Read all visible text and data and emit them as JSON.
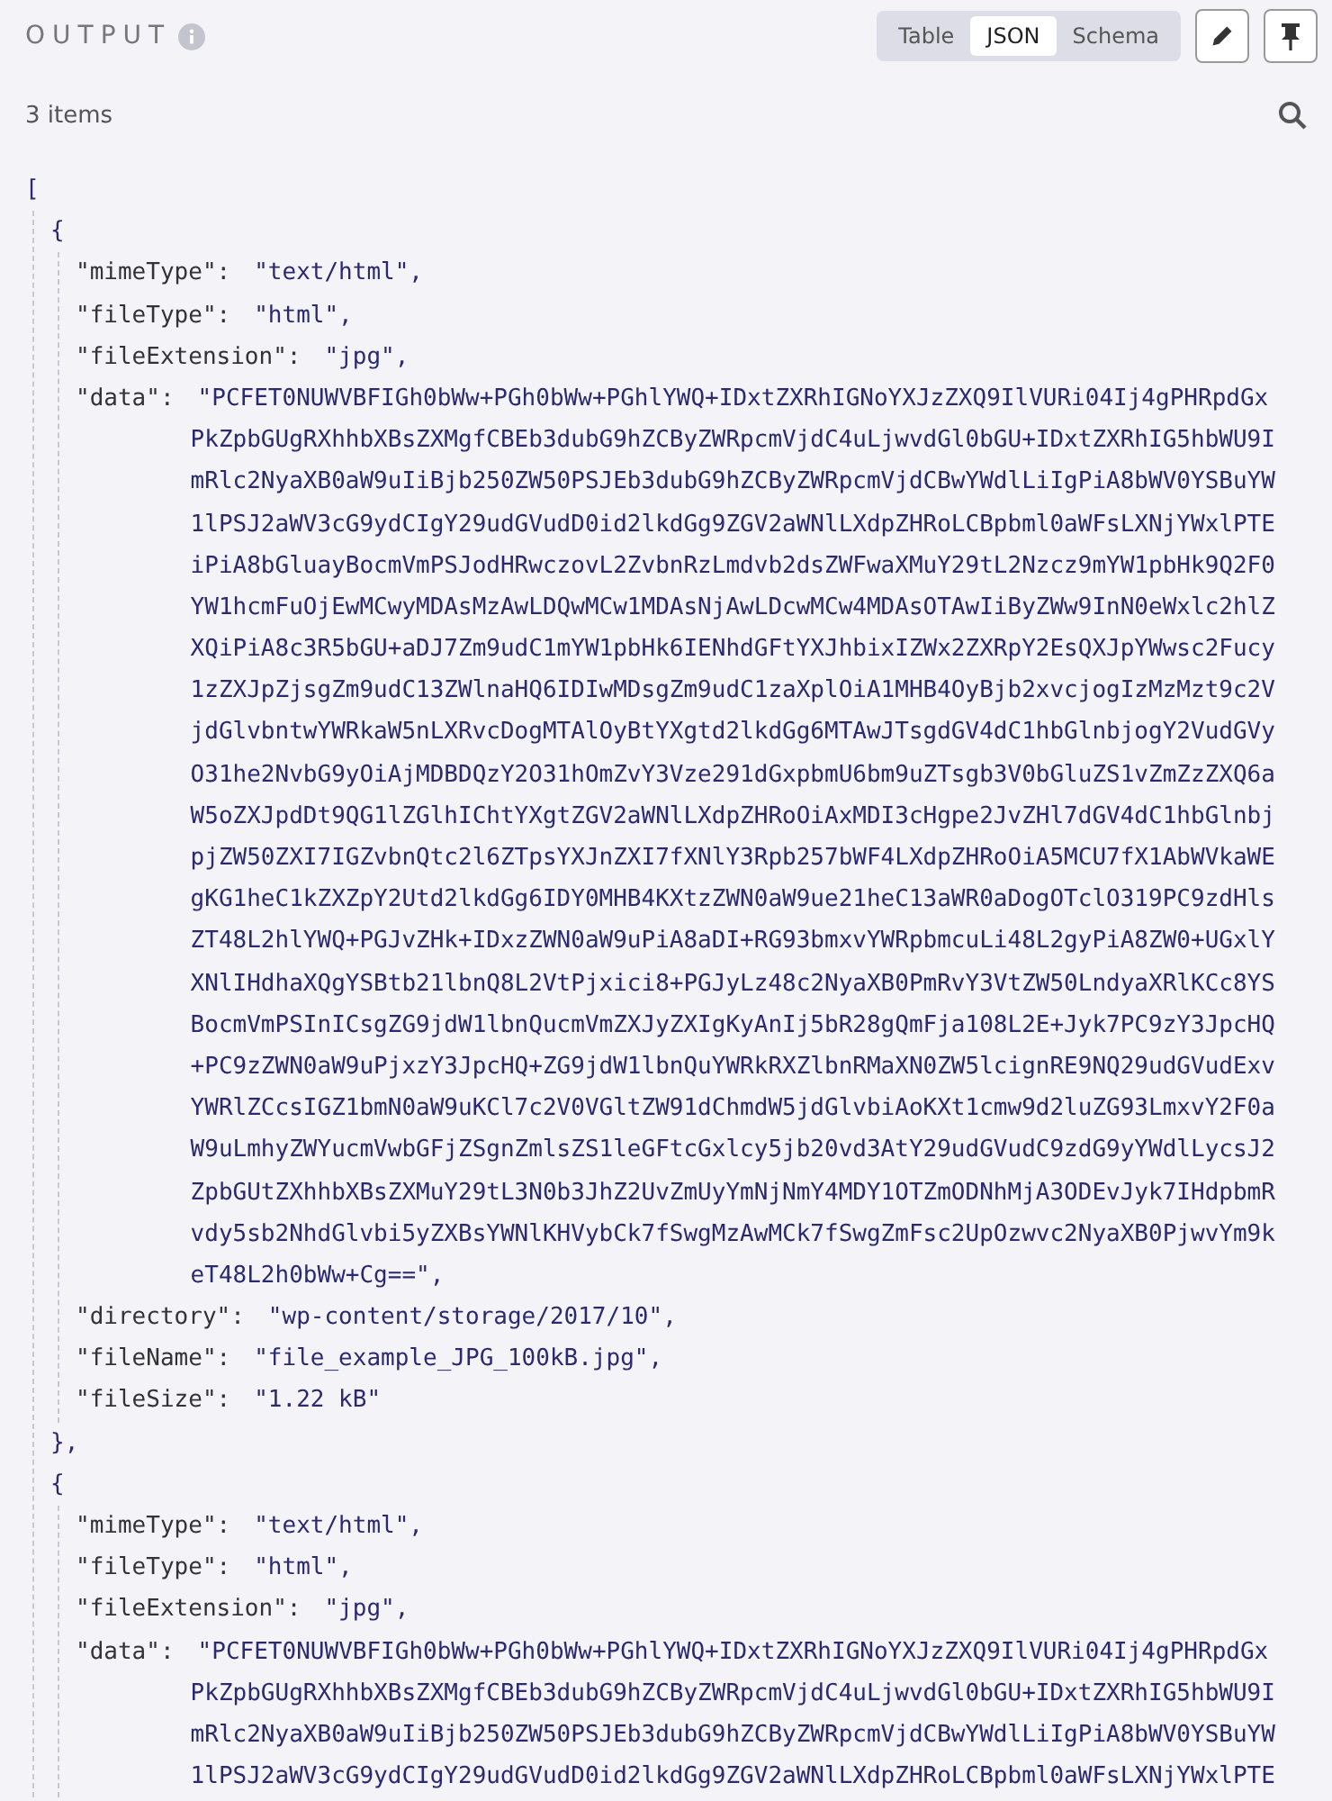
{
  "header": {
    "title": "OUTPUT",
    "tabs": [
      {
        "label": "Table",
        "selected": false
      },
      {
        "label": "JSON",
        "selected": true
      },
      {
        "label": "Schema",
        "selected": false
      }
    ]
  },
  "item_count": "3 items",
  "json": {
    "open": "[",
    "items": [
      {
        "open": "{",
        "fields": [
          {
            "key": "\"mimeType\":",
            "value": [
              "\"text/html\","
            ]
          },
          {
            "key": "\"fileType\":",
            "value": [
              "\"html\","
            ]
          },
          {
            "key": "\"fileExtension\":",
            "value": [
              "\"jpg\","
            ]
          },
          {
            "key": "\"data\":",
            "value": [
              "\"PCFET0NUWVBFIGh0bWw+PGh0bWw+PGhlYWQ+IDxtZXRhIGNoYXJzZXQ9IlVURi04Ij4gPHRpdGx",
              "PkZpbGUgRXhhbXBsZXMgfCBEb3dubG9hZCByZWRpcmVjdC4uLjwvdGl0bGU+IDxtZXRhIG5hbWU9I",
              "mRlc2NyaXB0aW9uIiBjb250ZW50PSJEb3dubG9hZCByZWRpcmVjdCBwYWdlLiIgPiA8bWV0YSBuYW",
              "1lPSJ2aWV3cG9ydCIgY29udGVudD0id2lkdGg9ZGV2aWNlLXdpZHRoLCBpbml0aWFsLXNjYWxlPTE",
              "iPiA8bGluayBocmVmPSJodHRwczovL2ZvbnRzLmdvb2dsZWFwaXMuY29tL2Nzcz9mYW1pbHk9Q2F0",
              "YW1hcmFuOjEwMCwyMDAsMzAwLDQwMCw1MDAsNjAwLDcwMCw4MDAsOTAwIiByZWw9InN0eWxlc2hlZ",
              "XQiPiA8c3R5bGU+aDJ7Zm9udC1mYW1pbHk6IENhdGFtYXJhbixIZWx2ZXRpY2EsQXJpYWwsc2Fucy",
              "1zZXJpZjsgZm9udC13ZWlnaHQ6IDIwMDsgZm9udC1zaXplOiA1MHB4OyBjb2xvcjogIzMzMzt9c2V",
              "jdGlvbntwYWRkaW5nLXRvcDogMTAlOyBtYXgtd2lkdGg6MTAwJTsgdGV4dC1hbGlnbjogY2VudGVy",
              "O31he2NvbG9yOiAjMDBDQzY2O31hOmZvY3Vze291dGxpbmU6bm9uZTsgb3V0bGluZS1vZmZzZXQ6a",
              "W5oZXJpdDt9QG1lZGlhIChtYXgtZGV2aWNlLXdpZHRoOiAxMDI3cHgpe2JvZHl7dGV4dC1hbGlnbj",
              "pjZW50ZXI7IGZvbnQtc2l6ZTpsYXJnZXI7fXNlY3Rpb257bWF4LXdpZHRoOiA5MCU7fX1AbWVkaWE",
              "gKG1heC1kZXZpY2Utd2lkdGg6IDY0MHB4KXtzZWN0aW9ue21heC13aWR0aDogOTclO319PC9zdHls",
              "ZT48L2hlYWQ+PGJvZHk+IDxzZWN0aW9uPiA8aDI+RG93bmxvYWRpbmcuLi48L2gyPiA8ZW0+UGxlY",
              "XNlIHdhaXQgYSBtb21lbnQ8L2VtPjxici8+PGJyLz48c2NyaXB0PmRvY3VtZW50LndyaXRlKCc8YS",
              "BocmVmPSInICsgZG9jdW1lbnQucmVmZXJyZXIgKyAnIj5bR28gQmFja108L2E+Jyk7PC9zY3JpcHQ",
              "+PC9zZWN0aW9uPjxzY3JpcHQ+ZG9jdW1lbnQuYWRkRXZlbnRMaXN0ZW5lcignRE9NQ29udGVudExv",
              "YWRlZCcsIGZ1bmN0aW9uKCl7c2V0VGltZW91dChmdW5jdGlvbiAoKXt1cmw9d2luZG93LmxvY2F0a",
              "W9uLmhyZWYucmVwbGFjZSgnZmlsZS1leGFtcGxlcy5jb20vd3AtY29udGVudC9zdG9yYWdlLycsJ2",
              "ZpbGUtZXhhbXBsZXMuY29tL3N0b3JhZ2UvZmUyYmNjNmY4MDY1OTZmODNhMjA3ODEvJyk7IHdpbmR",
              "vdy5sb2NhdGlvbi5yZXBsYWNlKHVybCk7fSwgMzAwMCk7fSwgZmFsc2UpOzwvc2NyaXB0PjwvYm9k",
              "eT48L2h0bWw+Cg==\","
            ]
          },
          {
            "key": "\"directory\":",
            "value": [
              "\"wp-content/storage/2017/10\","
            ]
          },
          {
            "key": "\"fileName\":",
            "value": [
              "\"file_example_JPG_100kB.jpg\","
            ]
          },
          {
            "key": "\"fileSize\":",
            "value": [
              "\"1.22 kB\""
            ]
          }
        ],
        "close": "},"
      },
      {
        "open": "{",
        "fields": [
          {
            "key": "\"mimeType\":",
            "value": [
              "\"text/html\","
            ]
          },
          {
            "key": "\"fileType\":",
            "value": [
              "\"html\","
            ]
          },
          {
            "key": "\"fileExtension\":",
            "value": [
              "\"jpg\","
            ]
          },
          {
            "key": "\"data\":",
            "value": [
              "\"PCFET0NUWVBFIGh0bWw+PGh0bWw+PGhlYWQ+IDxtZXRhIGNoYXJzZXQ9IlVURi04Ij4gPHRpdGx",
              "PkZpbGUgRXhhbXBsZXMgfCBEb3dubG9hZCByZWRpcmVjdC4uLjwvdGl0bGU+IDxtZXRhIG5hbWU9I",
              "mRlc2NyaXB0aW9uIiBjb250ZW50PSJEb3dubG9hZCByZWRpcmVjdCBwYWdlLiIgPiA8bWV0YSBuYW",
              "1lPSJ2aWV3cG9ydCIgY29udGVudD0id2lkdGg9ZGV2aWNlLXdpZHRoLCBpbml0aWFsLXNjYWxlPTE"
            ]
          }
        ]
      }
    ]
  }
}
